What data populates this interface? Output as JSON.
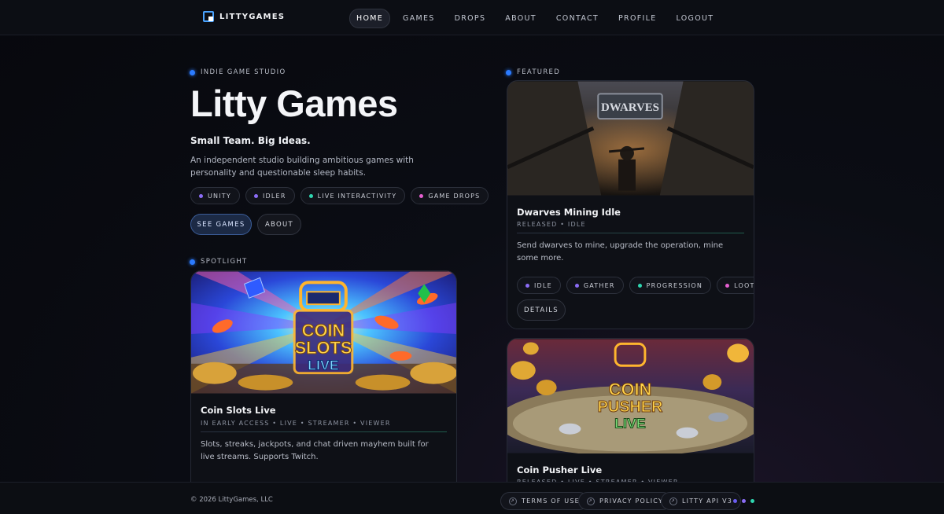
{
  "nav": {
    "brand": "LITTYGAMES",
    "links": [
      "HOME",
      "GAMES",
      "DROPS",
      "ABOUT",
      "CONTACT",
      "PROFILE",
      "LOGOUT"
    ],
    "active": "HOME"
  },
  "hero": {
    "eyebrow": "INDIE GAME STUDIO",
    "title": "Litty Games",
    "subtitle": "Small Team. Big Ideas.",
    "description": "An independent studio building ambitious games with personality and questionable sleep habits.",
    "tags": [
      {
        "label": "UNITY",
        "color": "#8b6cf5"
      },
      {
        "label": "IDLER",
        "color": "#8b6cf5"
      },
      {
        "label": "LIVE INTERACTIVITY",
        "color": "#2fd6b0"
      },
      {
        "label": "GAME DROPS",
        "color": "#e55fd0"
      }
    ],
    "primary_button": "SEE GAMES",
    "secondary_button": "ABOUT"
  },
  "spotlight": {
    "eyebrow": "SPOTLIGHT",
    "card": {
      "title": "Coin Slots Live",
      "meta": "IN EARLY ACCESS • LIVE • STREAMER • VIEWER",
      "description": "Slots, streaks, jackpots, and chat driven mayhem built for live streams. Supports Twitch.",
      "image_text": [
        "COIN",
        "SLOTS",
        "LIVE"
      ]
    }
  },
  "featured": {
    "eyebrow": "FEATURED",
    "cards": [
      {
        "title": "Dwarves Mining Idle",
        "meta": "RELEASED • IDLE",
        "description": "Send dwarves to mine, upgrade the operation, mine some more.",
        "tags": [
          {
            "label": "IDLE",
            "color": "#8b6cf5"
          },
          {
            "label": "GATHER",
            "color": "#8b6cf5"
          },
          {
            "label": "PROGRESSION",
            "color": "#2fd6b0"
          },
          {
            "label": "LOOT",
            "color": "#e55fd0"
          }
        ],
        "button": "DETAILS",
        "image_text": "DWARVES"
      },
      {
        "title": "Coin Pusher Live",
        "meta": "RELEASED • LIVE • STREAMER • VIEWER",
        "image_text": [
          "COIN",
          "PUSHER",
          "LIVE"
        ]
      }
    ]
  },
  "footer": {
    "copyright": "© 2026 LittyGames, LLC",
    "links": [
      "TERMS OF USE",
      "PRIVACY POLICY",
      "LITTY API V3"
    ],
    "dot_colors": [
      "#6a5cf0",
      "#8b6cf5",
      "#2fd6b0"
    ]
  }
}
